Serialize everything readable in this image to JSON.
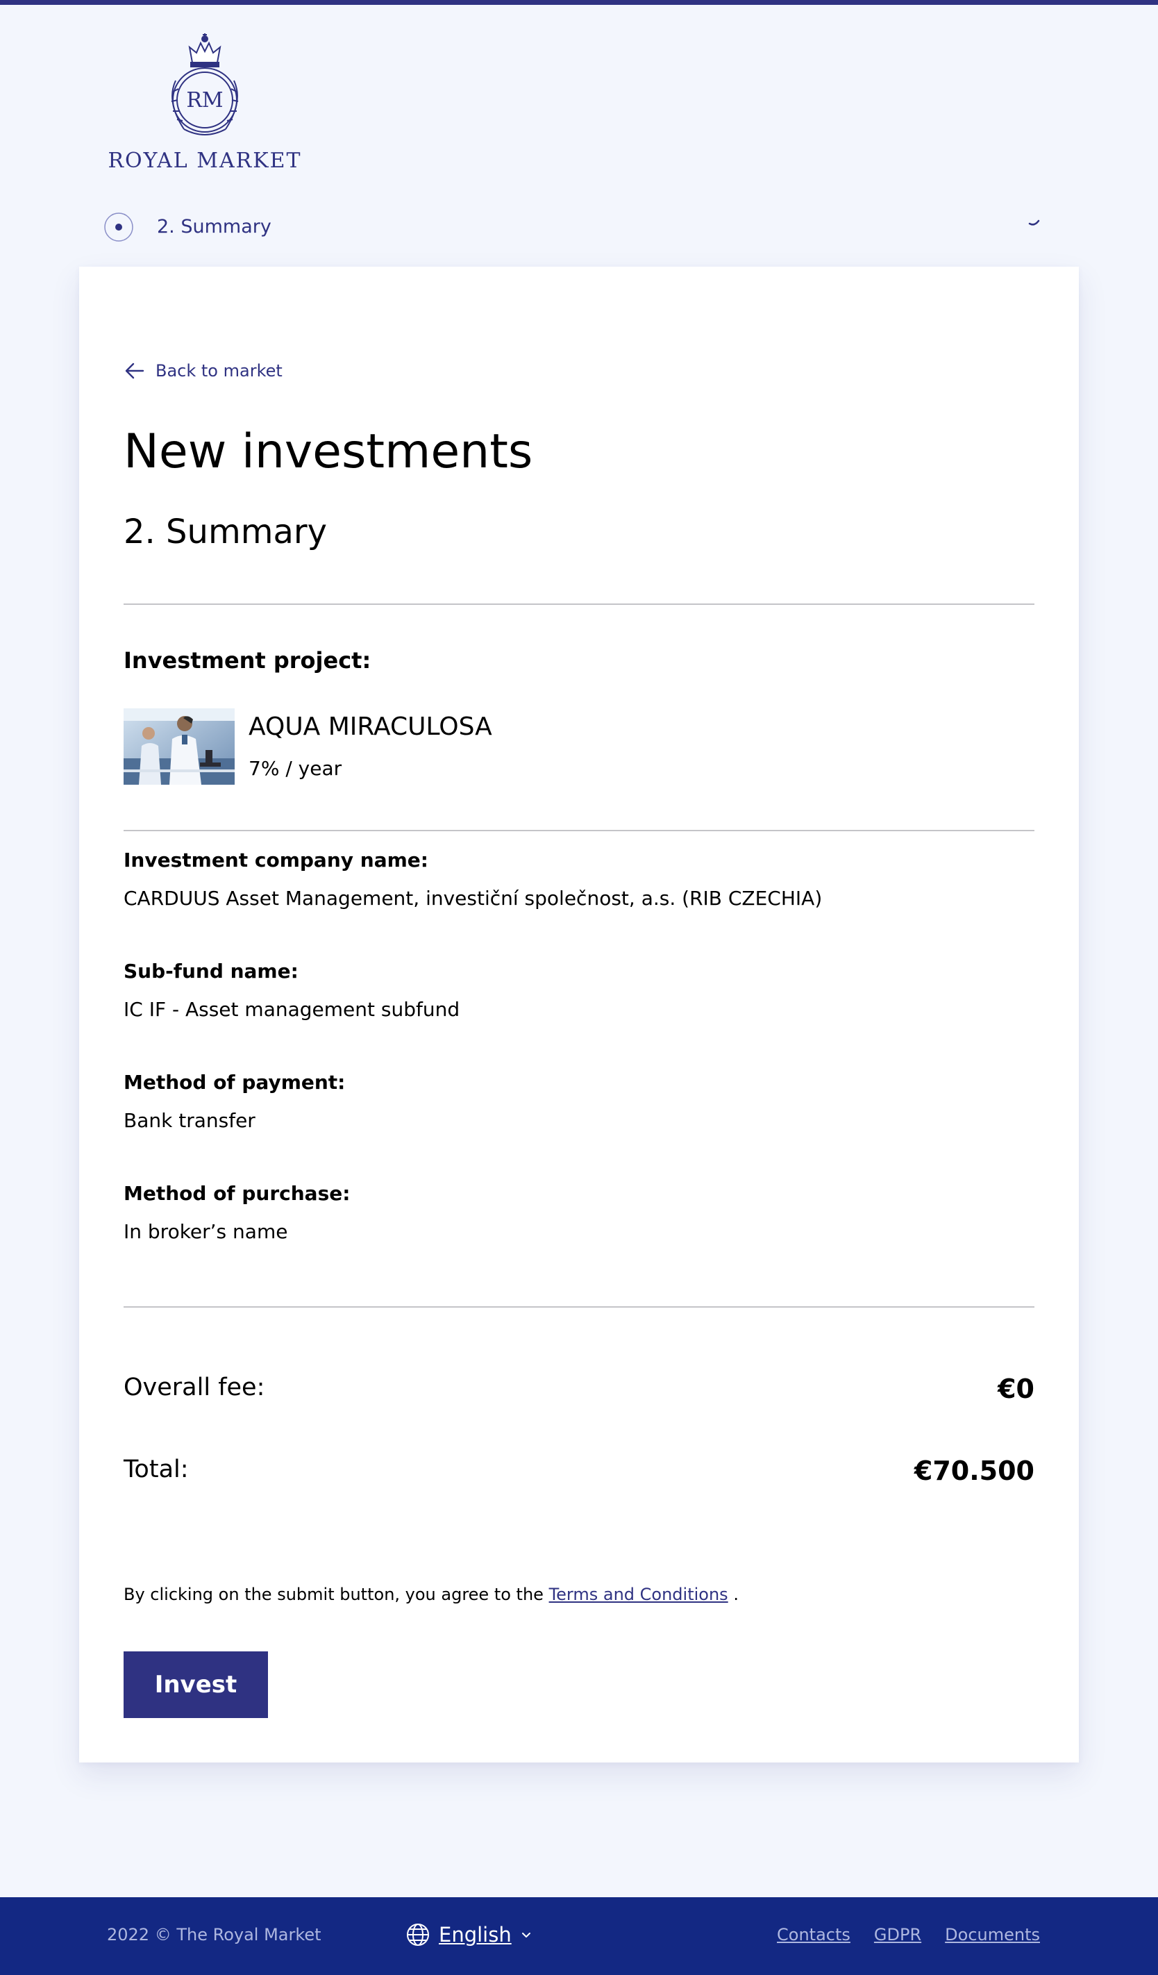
{
  "brand": {
    "name": "ROYAL MARKET",
    "monogram": "RM",
    "primary_color": "#2f3282",
    "footer_color": "#132883",
    "background_color": "#f3f6fd"
  },
  "steps": {
    "current_label": "2. Summary",
    "indicator_icon": "radio-dot-icon",
    "toggle_icon": "chevron-down-icon"
  },
  "card": {
    "back_link": "Back to market",
    "back_icon": "arrow-left-icon",
    "title": "New investments",
    "section_title": "2. Summary",
    "project": {
      "heading": "Investment project:",
      "name": "AQUA MIRACULOSA",
      "rate": "7% / year",
      "image": "scientists-in-laboratory-photo"
    },
    "details": [
      {
        "label": "Investment company name:",
        "value": "CARDUUS Asset Management, investiční společnost, a.s. (RIB CZECHIA)"
      },
      {
        "label": "Sub-fund name:",
        "value": "IC IF - Asset management subfund"
      },
      {
        "label": "Method of payment:",
        "value": "Bank transfer"
      },
      {
        "label": "Method of purchase:",
        "value": "In broker’s name"
      }
    ],
    "fees": {
      "overall_label": "Overall fee:",
      "overall_value": "€0",
      "total_label": "Total:",
      "total_value": "€70.500"
    },
    "consent": {
      "prefix": "By clicking on the submit button, you agree to the ",
      "link": "Terms and Conditions",
      "suffix": " ."
    },
    "submit_label": "Invest"
  },
  "footer": {
    "copyright": "2022 © The Royal Market",
    "language": "English",
    "language_icon": "globe-icon",
    "links": [
      "Contacts",
      "GDPR",
      "Documents"
    ]
  }
}
